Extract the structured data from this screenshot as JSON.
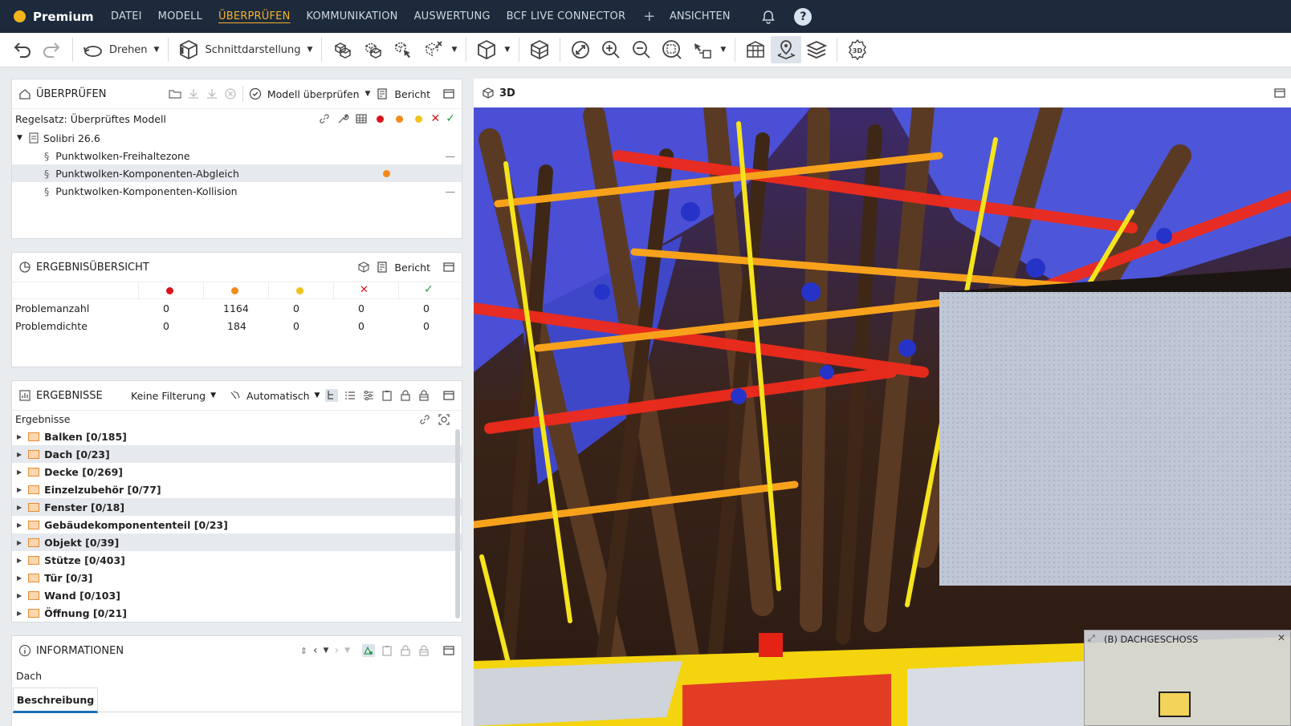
{
  "app": {
    "name": "Premium"
  },
  "menu": [
    "DATEI",
    "MODELL",
    "ÜBERPRÜFEN",
    "KOMMUNIKATION",
    "AUSWERTUNG",
    "BCF LIVE CONNECTOR"
  ],
  "menu_active": "ÜBERPRÜFEN",
  "menu_right": "ANSICHTEN",
  "toolbar": {
    "rotate_label": "Drehen",
    "section_label": "Schnittdarstellung",
    "threed_label": "3D"
  },
  "check_panel": {
    "title": "ÜBERPRÜFEN",
    "check_label": "Modell überprüfen",
    "report_label": "Bericht",
    "ruleset": "Regelsatz: Überprüftes Modell",
    "root": "Solibri 26.6",
    "rules": [
      {
        "label": "Punktwolken-Freihaltezone",
        "status": "—"
      },
      {
        "label": "Punktwolken-Komponenten-Abgleich",
        "status": "dot"
      },
      {
        "label": "Punktwolken-Komponenten-Kollision",
        "status": "—"
      }
    ]
  },
  "summary_panel": {
    "title": "ERGEBNISÜBERSICHT",
    "report_label": "Bericht",
    "rows": [
      {
        "label": "Problemanzahl",
        "values": [
          "0",
          "1164",
          "0",
          "0",
          "0"
        ]
      },
      {
        "label": "Problemdichte",
        "values": [
          "0",
          "184",
          "0",
          "0",
          "0"
        ]
      }
    ]
  },
  "results_panel": {
    "title": "ERGEBNISSE",
    "filter_label": "Keine Filterung",
    "auto_label": "Automatisch",
    "header": "Ergebnisse",
    "items": [
      "Balken [0/185]",
      "Dach [0/23]",
      "Decke [0/269]",
      "Einzelzubehör [0/77]",
      "Fenster [0/18]",
      "Gebäudekomponententeil [0/23]",
      "Objekt [0/39]",
      "Stütze [0/403]",
      "Tür [0/3]",
      "Wand [0/103]",
      "Öffnung [0/21]"
    ]
  },
  "info_panel": {
    "title": "INFORMATIONEN",
    "selected": "Dach",
    "tab": "Beschreibung"
  },
  "view3d": {
    "title": "3D",
    "minimap_label": "(B) DACHGESCHOSS"
  },
  "colors": {
    "red": "#d9151b",
    "orange": "#f28b1a",
    "yellow": "#f1c21b",
    "green": "#1f9e4a",
    "accent": "#f4b22a"
  }
}
